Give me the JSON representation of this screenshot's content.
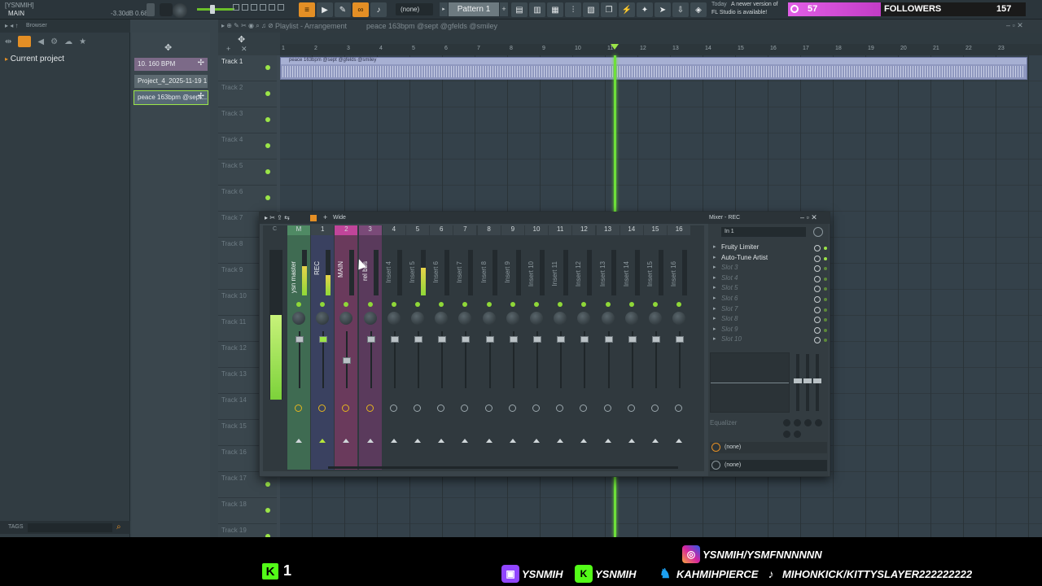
{
  "topbar": {
    "project_tag": "[YSNMIH]",
    "channel_label": "MAIN",
    "volume_db": "-3.30dB",
    "volume_val": "0.68",
    "snap": "(none)",
    "pattern": "Pattern 1",
    "news_date": "Today",
    "news_line1": "A newer version of",
    "news_line2": "FL Studio is available!"
  },
  "twitch": {
    "count_left": "57",
    "label": "FOLLOWERS",
    "count_right": "157"
  },
  "browser": {
    "title": "Browser",
    "root": "Current project",
    "tags_label": "TAGS"
  },
  "patterns": [
    "10. 160 BPM",
    "Project_4_2025-11-19 1...",
    "peace 163bpm @sept..."
  ],
  "playlist": {
    "title": "Playlist - Arrangement",
    "arrangement": "peace 163bpm @sept @gfelds @smiley",
    "clip_label": "peace 163bpm @sept @gfelds @smiley",
    "tracks": [
      "Track 1",
      "Track 2",
      "Track 3",
      "Track 4",
      "Track 5",
      "Track 6",
      "Track 7",
      "Track 8",
      "Track 9",
      "Track 10",
      "Track 11",
      "Track 12",
      "Track 13",
      "Track 14",
      "Track 15",
      "Track 16",
      "Track 17",
      "Track 18",
      "Track 19"
    ],
    "ruler": [
      "1",
      "2",
      "3",
      "4",
      "5",
      "6",
      "7",
      "8",
      "9",
      "10",
      "11",
      "12",
      "13",
      "14",
      "15",
      "16",
      "17",
      "18",
      "19",
      "20",
      "21",
      "22",
      "23"
    ]
  },
  "mixer": {
    "title": "Mixer - REC",
    "view_mode": "Wide",
    "input": "In 1",
    "master_letter": "C",
    "channels": [
      {
        "num": "M",
        "name": "ysn master"
      },
      {
        "num": "1",
        "name": "REC"
      },
      {
        "num": "2",
        "name": "MAIN"
      },
      {
        "num": "3",
        "name": "rel bbs"
      },
      {
        "num": "4",
        "name": "Insert 4"
      },
      {
        "num": "5",
        "name": "Insert 5"
      },
      {
        "num": "6",
        "name": "Insert 6"
      },
      {
        "num": "7",
        "name": "Insert 7"
      },
      {
        "num": "8",
        "name": "Insert 8"
      },
      {
        "num": "9",
        "name": "Insert 9"
      },
      {
        "num": "10",
        "name": "Insert 10"
      },
      {
        "num": "11",
        "name": "Insert 11"
      },
      {
        "num": "12",
        "name": "Insert 12"
      },
      {
        "num": "13",
        "name": "Insert 13"
      },
      {
        "num": "14",
        "name": "Insert 14"
      },
      {
        "num": "15",
        "name": "Insert 15"
      },
      {
        "num": "16",
        "name": "Insert 16"
      }
    ],
    "slots": [
      {
        "name": "Fruity Limiter",
        "active": true
      },
      {
        "name": "Auto-Tune Artist",
        "active": true
      },
      {
        "name": "Slot 3",
        "active": false
      },
      {
        "name": "Slot 4",
        "active": false
      },
      {
        "name": "Slot 5",
        "active": false
      },
      {
        "name": "Slot 6",
        "active": false
      },
      {
        "name": "Slot 7",
        "active": false
      },
      {
        "name": "Slot 8",
        "active": false
      },
      {
        "name": "Slot 9",
        "active": false
      },
      {
        "name": "Slot 10",
        "active": false
      }
    ],
    "eq_label": "Equalizer",
    "out1": "(none)",
    "out2": "(none)"
  },
  "overlay": {
    "kick_count": "1",
    "instagram": "YSNMIH/YSMFNNNNNN",
    "twitch": "YSNMIH",
    "kick": "YSNMIH",
    "twitter": "KAHMIHPIERCE",
    "tiktok": "MIHONKICK/KITTYSLAYER222222222"
  },
  "colors": {
    "accent_green": "#9be548",
    "kick_green": "#53fc18",
    "twitch_purple": "#9146ff",
    "pink": "#e15fe6",
    "playhead": "#6ee03a"
  }
}
